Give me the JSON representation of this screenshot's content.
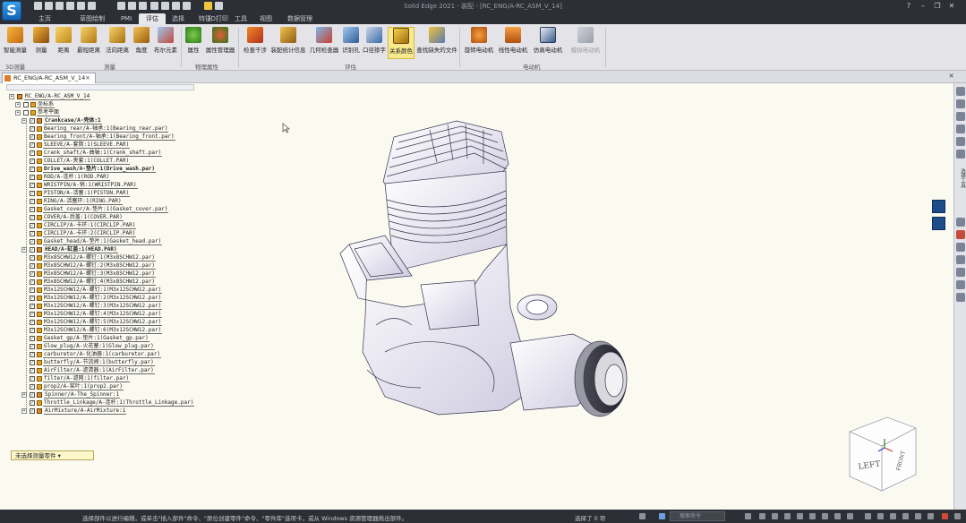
{
  "window": {
    "title": "Solid Edge 2021 - 装配 - [RC_ENG/A-RC_ASM_V_14]",
    "logo_letter": "S"
  },
  "menu_tabs": [
    "主页",
    "草图绘制",
    "评估",
    "选择",
    "特征",
    "视图",
    "3D打印",
    "工具",
    "视图",
    "数据管理"
  ],
  "active_menu_index": 2,
  "ribbon": {
    "groups": [
      {
        "label": "3D测量",
        "buttons": [
          "智能测量",
          "测量",
          "距离",
          "最短距离",
          "法向距离",
          "角度",
          "布尔元素"
        ]
      },
      {
        "label": "物理属性",
        "buttons": [
          "属性",
          "属性管理器"
        ]
      },
      {
        "label": "评估",
        "buttons": [
          "检查干涉",
          "装配统计信息",
          "几何检查器",
          "识别孔",
          "口径掺字",
          "关系颜色",
          "查找缺失的文件"
        ]
      },
      {
        "label": "电动机",
        "buttons": [
          "旋转电动机",
          "线性电动机",
          "仿真电动机",
          "模拟电动机"
        ]
      }
    ],
    "active_button": "关系颜色"
  },
  "doc_tab": {
    "label": "RC_ENG/A-RC_ASM_V_14",
    "close": "×"
  },
  "tree": {
    "root": "RC_ENG/A-RC_ASM_V_14",
    "folders": [
      "坐标系",
      "参考平面"
    ],
    "items": [
      {
        "text": "Crankcase/A-壳体:1",
        "bold": true,
        "assembly": true
      },
      {
        "text": "Bearing_rear/A-轴承:1(Bearing_rear.par)",
        "bold": false,
        "assembly": false
      },
      {
        "text": "Bearing_front/A-轴承:1(Bearing_front.par)",
        "bold": false,
        "assembly": false
      },
      {
        "text": "SLEEVE/A-套筒:1(SLEEVE.PAR)",
        "bold": false,
        "assembly": false
      },
      {
        "text": "Crank_shaft/A-曲轴:1(Crank_shaft.par)",
        "bold": false,
        "assembly": false
      },
      {
        "text": "COLLET/A-夹套:1(COLLET.PAR)",
        "bold": false,
        "assembly": false
      },
      {
        "text": "Drive_wash/A-垫片:1(Drive_wash.par)",
        "bold": true,
        "assembly": false
      },
      {
        "text": "ROD/A-连杆:1(ROD.PAR)",
        "bold": false,
        "assembly": false
      },
      {
        "text": "WRISTPIN/A-销:1(WRISTPIN.PAR)",
        "bold": false,
        "assembly": false
      },
      {
        "text": "PISTON/A-活塞:1(PISTON.PAR)",
        "bold": false,
        "assembly": false
      },
      {
        "text": "RING/A-活塞环:1(RING.PAR)",
        "bold": false,
        "assembly": false
      },
      {
        "text": "Gasket_cover/A-垫片:1(Gasket_cover.par)",
        "bold": false,
        "assembly": false
      },
      {
        "text": "COVER/A-后盖:1(COVER.PAR)",
        "bold": false,
        "assembly": false
      },
      {
        "text": "CIRCLIP/A-卡环:1(CIRCLIP.PAR)",
        "bold": false,
        "assembly": false
      },
      {
        "text": "CIRCLIP/A-卡环:2(CIRCLIP.PAR)",
        "bold": false,
        "assembly": false
      },
      {
        "text": "Gasket_head/A-垫片:1(Gasket_head.par)",
        "bold": false,
        "assembly": false
      },
      {
        "text": "HEAD/A-缸盖:1(HEAD.PAR)",
        "bold": true,
        "assembly": true
      },
      {
        "text": "M3x8SCHW12/A-螺钉:1(M3x8SCHW12.par)",
        "bold": false,
        "assembly": false
      },
      {
        "text": "M3x8SCHW12/A-螺钉:2(M3x8SCHW12.par)",
        "bold": false,
        "assembly": false
      },
      {
        "text": "M3x8SCHW12/A-螺钉:3(M3x8SCHW12.par)",
        "bold": false,
        "assembly": false
      },
      {
        "text": "M3x8SCHW12/A-螺钉:4(M3x8SCHW12.par)",
        "bold": false,
        "assembly": false
      },
      {
        "text": "M3x12SCHW12/A-螺钉:1(M3x12SCHW12.par)",
        "bold": false,
        "assembly": false
      },
      {
        "text": "M3x12SCHW12/A-螺钉:2(M3x12SCHW12.par)",
        "bold": false,
        "assembly": false
      },
      {
        "text": "M3x12SCHW12/A-螺钉:3(M3x12SCHW12.par)",
        "bold": false,
        "assembly": false
      },
      {
        "text": "M3x12SCHW12/A-螺钉:4(M3x12SCHW12.par)",
        "bold": false,
        "assembly": false
      },
      {
        "text": "M3x12SCHW12/A-螺钉:5(M3x12SCHW12.par)",
        "bold": false,
        "assembly": false
      },
      {
        "text": "M3x12SCHW12/A-螺钉:6(M3x12SCHW12.par)",
        "bold": false,
        "assembly": false
      },
      {
        "text": "Gasket_gp/A-垫片:1(Gasket_gp.par)",
        "bold": false,
        "assembly": false
      },
      {
        "text": "Glow_plug/A-火花塞:1(Glow_plug.par)",
        "bold": false,
        "assembly": false
      },
      {
        "text": "carburetor/A-化油器:1(carburetor.par)",
        "bold": false,
        "assembly": false
      },
      {
        "text": "butterfly/A-节流阀:1(butterfly.par)",
        "bold": false,
        "assembly": false
      },
      {
        "text": "AirFilter/A-滤清器:1(AirFilter.par)",
        "bold": false,
        "assembly": false
      },
      {
        "text": "filter/A-滤网:1(filter.par)",
        "bold": false,
        "assembly": false
      },
      {
        "text": "prop2/A-桨叶:1(prop2.par)",
        "bold": false,
        "assembly": false
      },
      {
        "text": "Spinner/A-The_Spinner:1",
        "bold": false,
        "assembly": true
      },
      {
        "text": "Throttle_Linkage/A-连杆:1(Throttle_Linkage.par)",
        "bold": false,
        "assembly": false
      },
      {
        "text": "AirMixture/A-AirMixture:1",
        "bold": false,
        "assembly": true
      }
    ]
  },
  "filter_button": {
    "label": "未选择测量零件"
  },
  "viewcube": {
    "face_left": "LEFT",
    "face_front": "FRONT"
  },
  "rightbar": {
    "vertical_label": "选择工具"
  },
  "statusbar": {
    "message": "选择部件以进行编辑，或单击\"插入部件\"命令、\"原位创建零件\"命令、\"零件库\"选项卡，或从 Windows 资源管理器拖出部件。",
    "selection": "选择了 0 项",
    "search_placeholder": "搜索命令"
  },
  "colors": {
    "chrome": "#2c2f35",
    "ribbon": "#e4e4e8",
    "viewport": "#fbfaf1",
    "model_body": "#eceaf3",
    "model_line": "#3a3550",
    "active_button": "#f7e98e"
  }
}
